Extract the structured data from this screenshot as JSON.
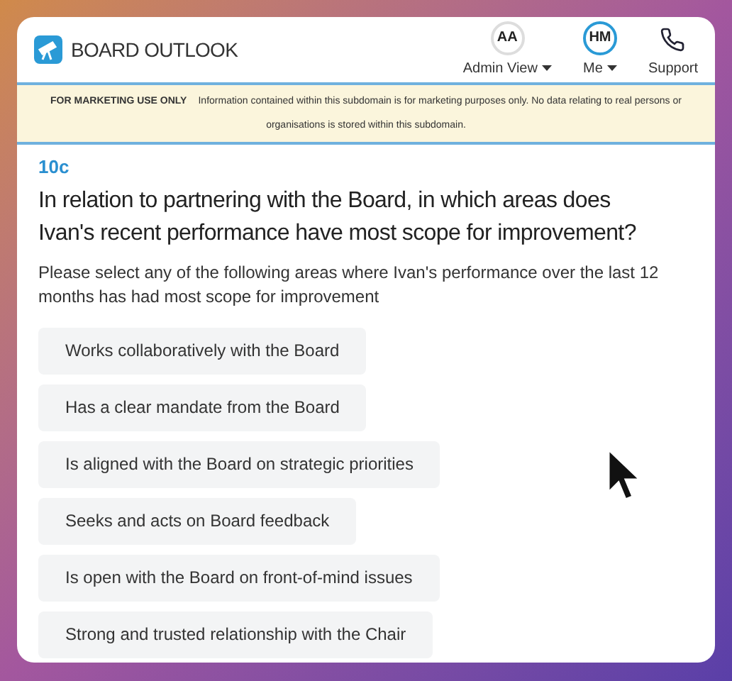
{
  "header": {
    "logo_text": "BOARD OUTLOOK",
    "menus": [
      {
        "kind": "avatar",
        "initials": "AA",
        "label": "Admin View",
        "highlighted": false
      },
      {
        "kind": "avatar",
        "initials": "HM",
        "label": "Me",
        "highlighted": true
      },
      {
        "kind": "phone",
        "label": "Support"
      }
    ]
  },
  "banner": {
    "title": "FOR MARKETING USE ONLY",
    "text": "Information contained within this subdomain is for marketing purposes only. No data relating to real persons or organisations is stored within this subdomain."
  },
  "question": {
    "number": "10c",
    "title": "In relation to partnering with the Board, in which areas does Ivan's recent performance have most scope for improvement?",
    "instruction": "Please select any of the following areas where Ivan's performance over the last 12 months has had most scope for improvement",
    "options": [
      {
        "label": "Works collaboratively with the Board",
        "selected": false
      },
      {
        "label": "Has a clear mandate from the Board",
        "selected": false
      },
      {
        "label": "Is aligned with the Board on strategic priorities",
        "selected": false
      },
      {
        "label": "Seeks and acts on Board feedback",
        "selected": false
      },
      {
        "label": "Is open with the Board on front-of-mind issues",
        "selected": false
      },
      {
        "label": "Strong and trusted relationship with the Chair",
        "selected": false
      }
    ]
  }
}
